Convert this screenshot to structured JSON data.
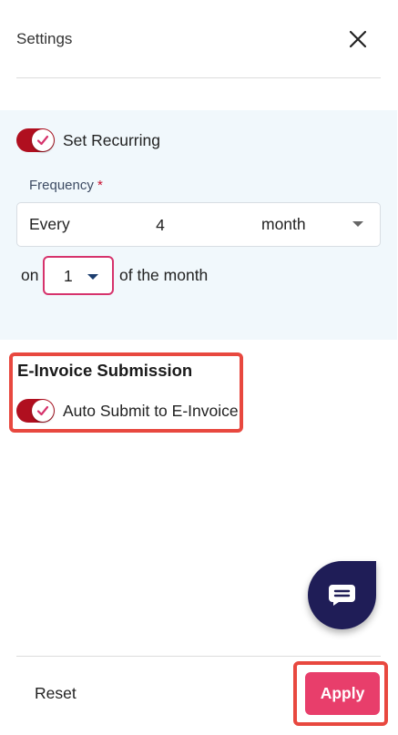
{
  "header": {
    "title": "Settings",
    "close_icon": "close-icon"
  },
  "recurring": {
    "toggle_label": "Set Recurring",
    "toggle_on": true,
    "frequency_label": "Frequency",
    "required_marker": "*",
    "every_label": "Every",
    "count_value": "4",
    "unit_value": "month",
    "on_label": "on",
    "day_value": "1",
    "of_month_label": "of the month"
  },
  "einvoice": {
    "section_title": "E-Invoice Submission",
    "toggle_label": "Auto Submit to E-Invoice",
    "toggle_on": true
  },
  "chat": {
    "icon": "chat-icon",
    "color": "#1f1d57"
  },
  "footer": {
    "reset_label": "Reset",
    "apply_label": "Apply"
  },
  "colors": {
    "toggle_on": "#b00f1f",
    "accent_pink": "#e83e6b",
    "highlight_red": "#e8483f",
    "panel_bg": "#f1f8fc"
  }
}
